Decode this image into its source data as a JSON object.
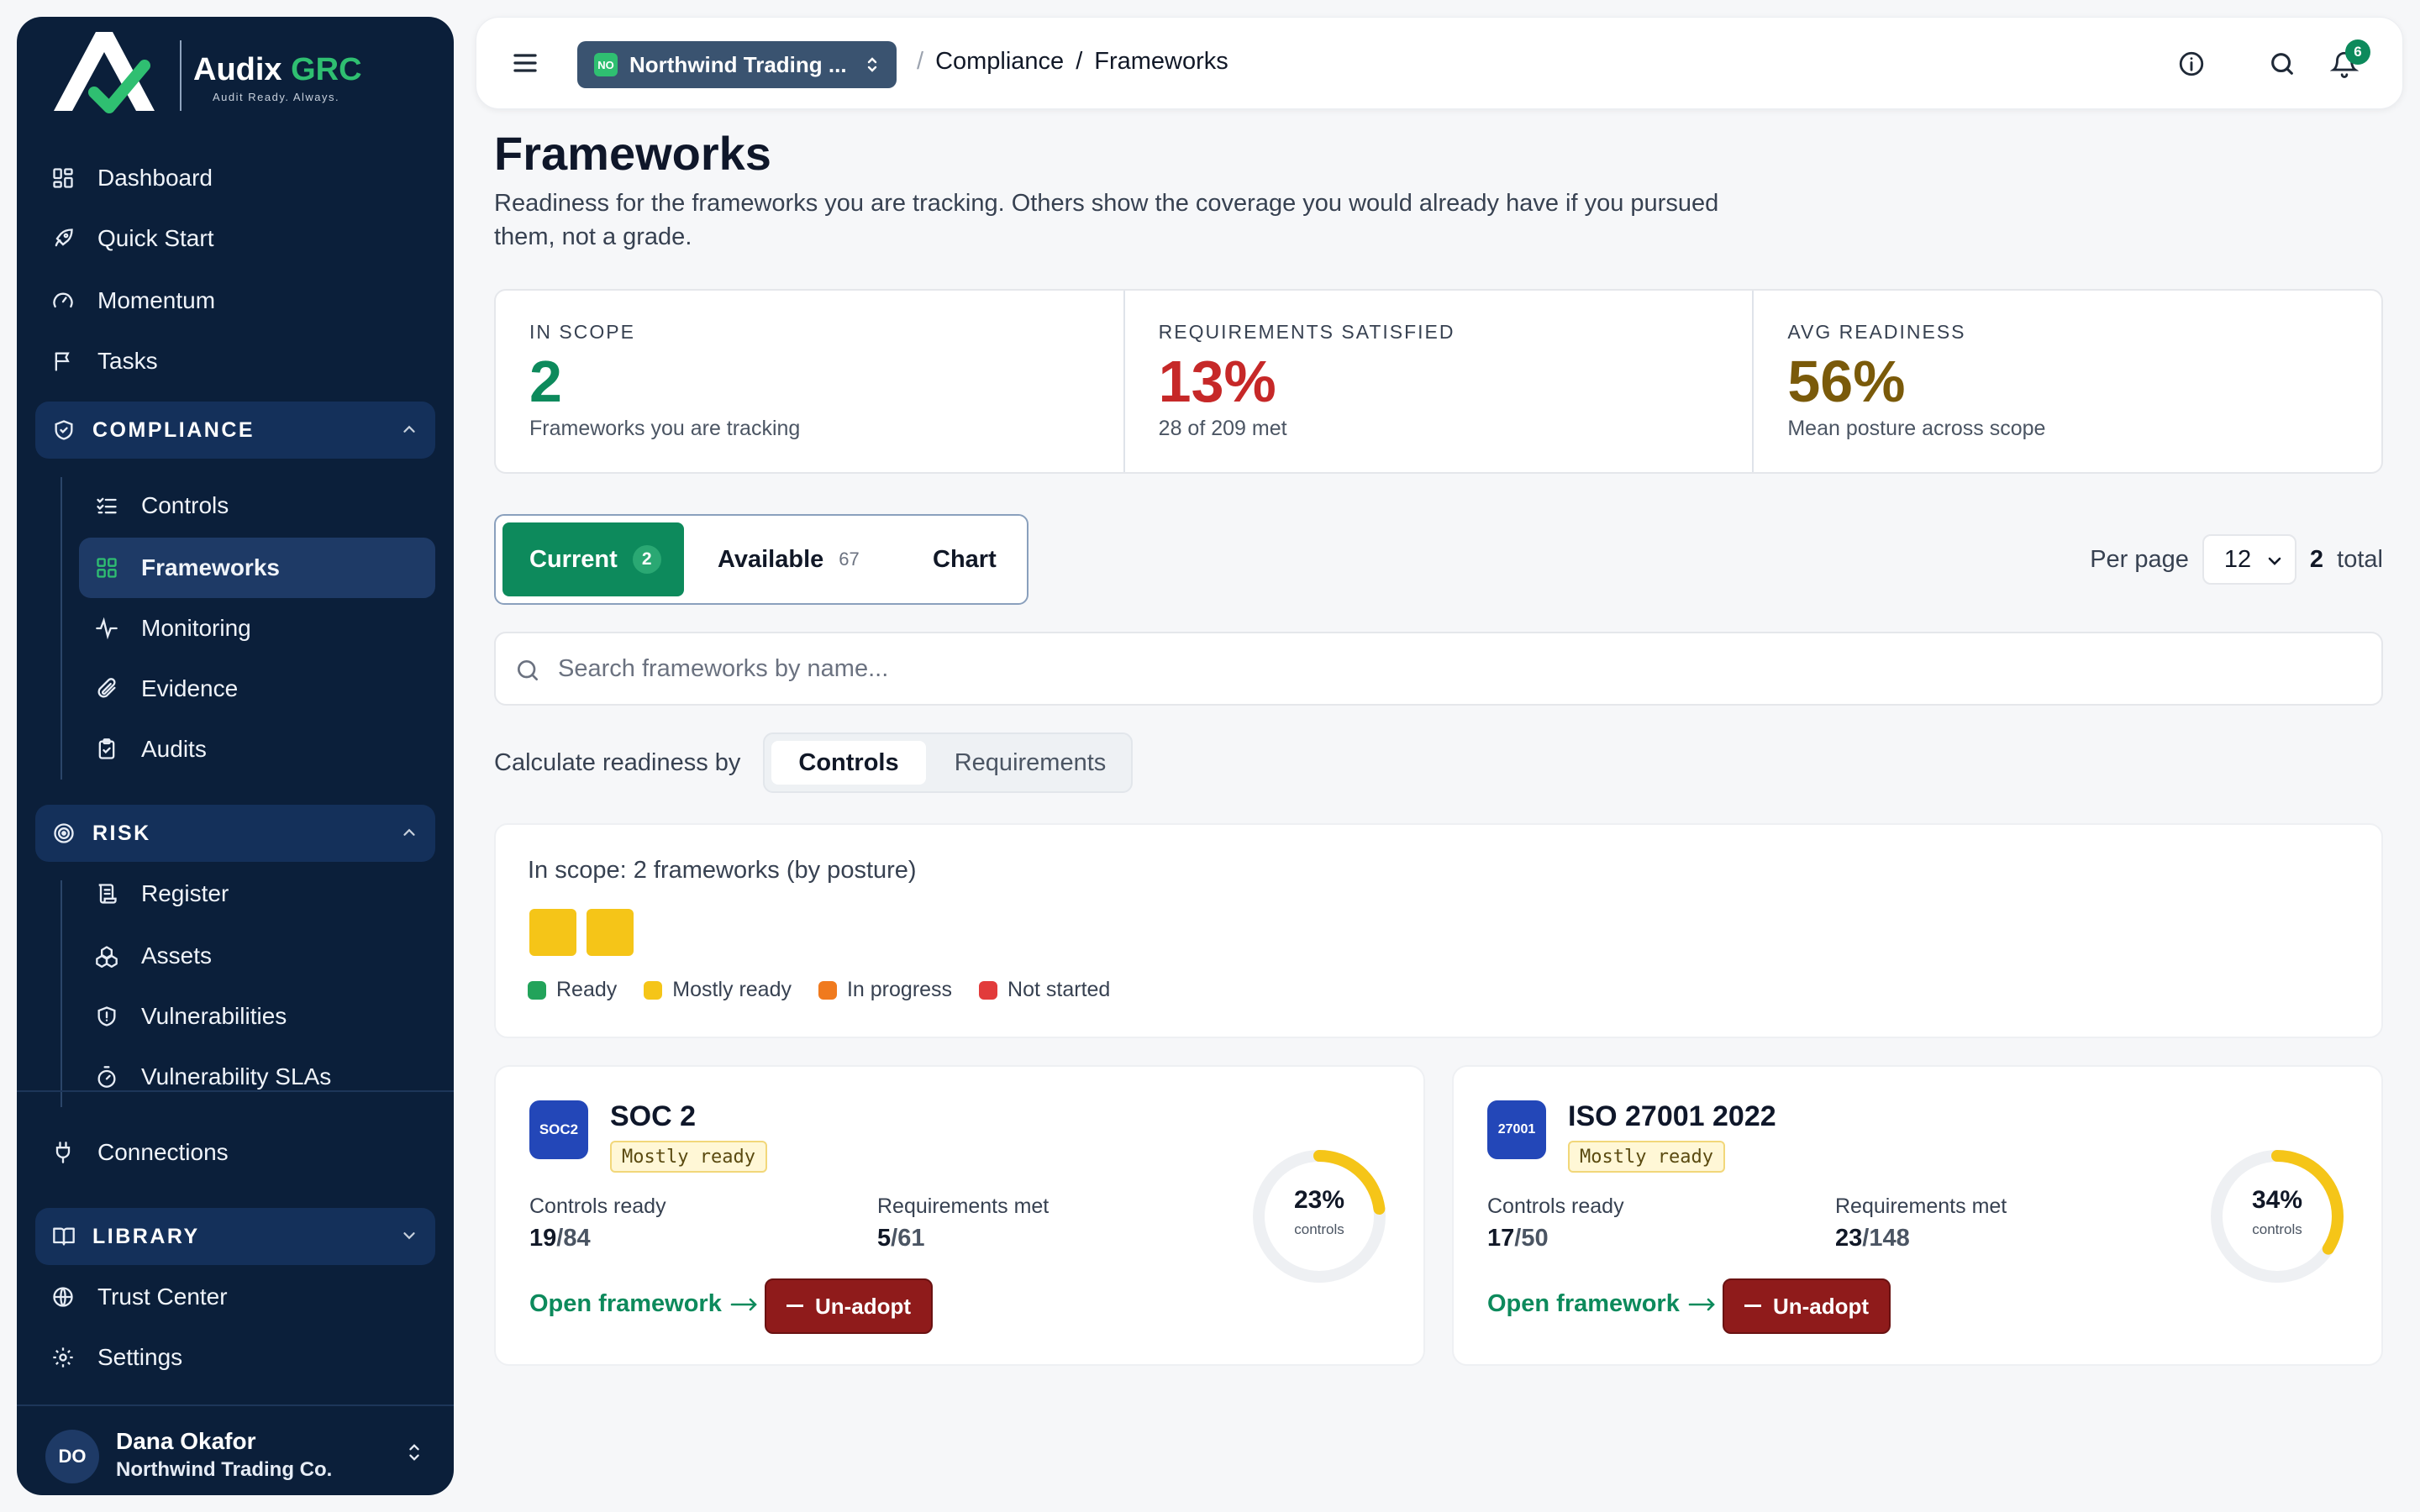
{
  "brand": {
    "name": "Audix",
    "name_accent": "GRC",
    "tagline": "Audit Ready. Always."
  },
  "sidebar": {
    "top_items": [
      {
        "label": "Dashboard",
        "icon": "dashboard-icon"
      },
      {
        "label": "Quick Start",
        "icon": "rocket-icon"
      },
      {
        "label": "Momentum",
        "icon": "gauge-icon"
      },
      {
        "label": "Tasks",
        "icon": "flag-icon"
      }
    ],
    "compliance": {
      "label": "COMPLIANCE",
      "items": [
        {
          "label": "Controls",
          "icon": "list-check-icon"
        },
        {
          "label": "Frameworks",
          "icon": "grid-icon",
          "active": true
        },
        {
          "label": "Monitoring",
          "icon": "activity-icon"
        },
        {
          "label": "Evidence",
          "icon": "paperclip-icon"
        },
        {
          "label": "Audits",
          "icon": "clipboard-icon"
        }
      ]
    },
    "risk": {
      "label": "RISK",
      "items": [
        {
          "label": "Register",
          "icon": "scroll-icon"
        },
        {
          "label": "Assets",
          "icon": "boxes-icon"
        },
        {
          "label": "Vulnerabilities",
          "icon": "shield-alert-icon"
        },
        {
          "label": "Vulnerability SLAs",
          "icon": "timer-icon"
        }
      ]
    },
    "connections": {
      "label": "Connections",
      "icon": "plug-icon"
    },
    "library": {
      "label": "LIBRARY"
    },
    "bottom_items": [
      {
        "label": "Trust Center",
        "icon": "globe-icon"
      },
      {
        "label": "Settings",
        "icon": "gear-icon"
      }
    ],
    "user": {
      "initials": "DO",
      "name": "Dana Okafor",
      "org": "Northwind Trading Co."
    }
  },
  "topbar": {
    "org_badge": "NO",
    "org_name": "Northwind Trading ...",
    "breadcrumb": [
      "Compliance",
      "/",
      "Frameworks"
    ],
    "notification_count": "6"
  },
  "page": {
    "title": "Frameworks",
    "description": "Readiness for the frameworks you are tracking. Others show the coverage you would already have if you pursued them, not a grade."
  },
  "stats": [
    {
      "label": "IN SCOPE",
      "value": "2",
      "sub": "Frameworks you are tracking",
      "color": "#0d8a5c"
    },
    {
      "label": "REQUIREMENTS SATISFIED",
      "value": "13%",
      "sub": "28 of 209 met",
      "color": "#c62828"
    },
    {
      "label": "AVG READINESS",
      "value": "56%",
      "sub": "Mean posture across scope",
      "color": "#7a5a0a"
    }
  ],
  "tabs": {
    "current": {
      "label": "Current",
      "count": "2"
    },
    "available": {
      "label": "Available",
      "count": "67"
    },
    "chart": {
      "label": "Chart"
    }
  },
  "pagination": {
    "per_page_label": "Per page",
    "per_page_value": "12",
    "total_count": "2",
    "total_label": "total"
  },
  "search": {
    "placeholder": "Search frameworks by name..."
  },
  "calc": {
    "label": "Calculate readiness by",
    "options": [
      "Controls",
      "Requirements"
    ],
    "selected": "Controls"
  },
  "scope": {
    "title": "In scope: 2 frameworks (by posture)",
    "legend": [
      {
        "label": "Ready",
        "color": "#22a35a"
      },
      {
        "label": "Mostly ready",
        "color": "#f5c518"
      },
      {
        "label": "In progress",
        "color": "#f07a1e"
      },
      {
        "label": "Not started",
        "color": "#e23b3b"
      }
    ]
  },
  "frameworks": [
    {
      "logo": "SOC2",
      "name": "SOC 2",
      "status": "Mostly ready",
      "controls_label": "Controls ready",
      "controls_done": "19",
      "controls_total": "/84",
      "req_label": "Requirements met",
      "req_done": "5",
      "req_total": "/61",
      "percent": "23%",
      "percent_value": 23,
      "ring_sub": "controls",
      "open_label": "Open framework",
      "unadopt_label": "Un-adopt"
    },
    {
      "logo": "27001",
      "name": "ISO 27001 2022",
      "status": "Mostly ready",
      "controls_label": "Controls ready",
      "controls_done": "17",
      "controls_total": "/50",
      "req_label": "Requirements met",
      "req_done": "23",
      "req_total": "/148",
      "percent": "34%",
      "percent_value": 34,
      "ring_sub": "controls",
      "open_label": "Open framework",
      "unadopt_label": "Un-adopt"
    }
  ]
}
